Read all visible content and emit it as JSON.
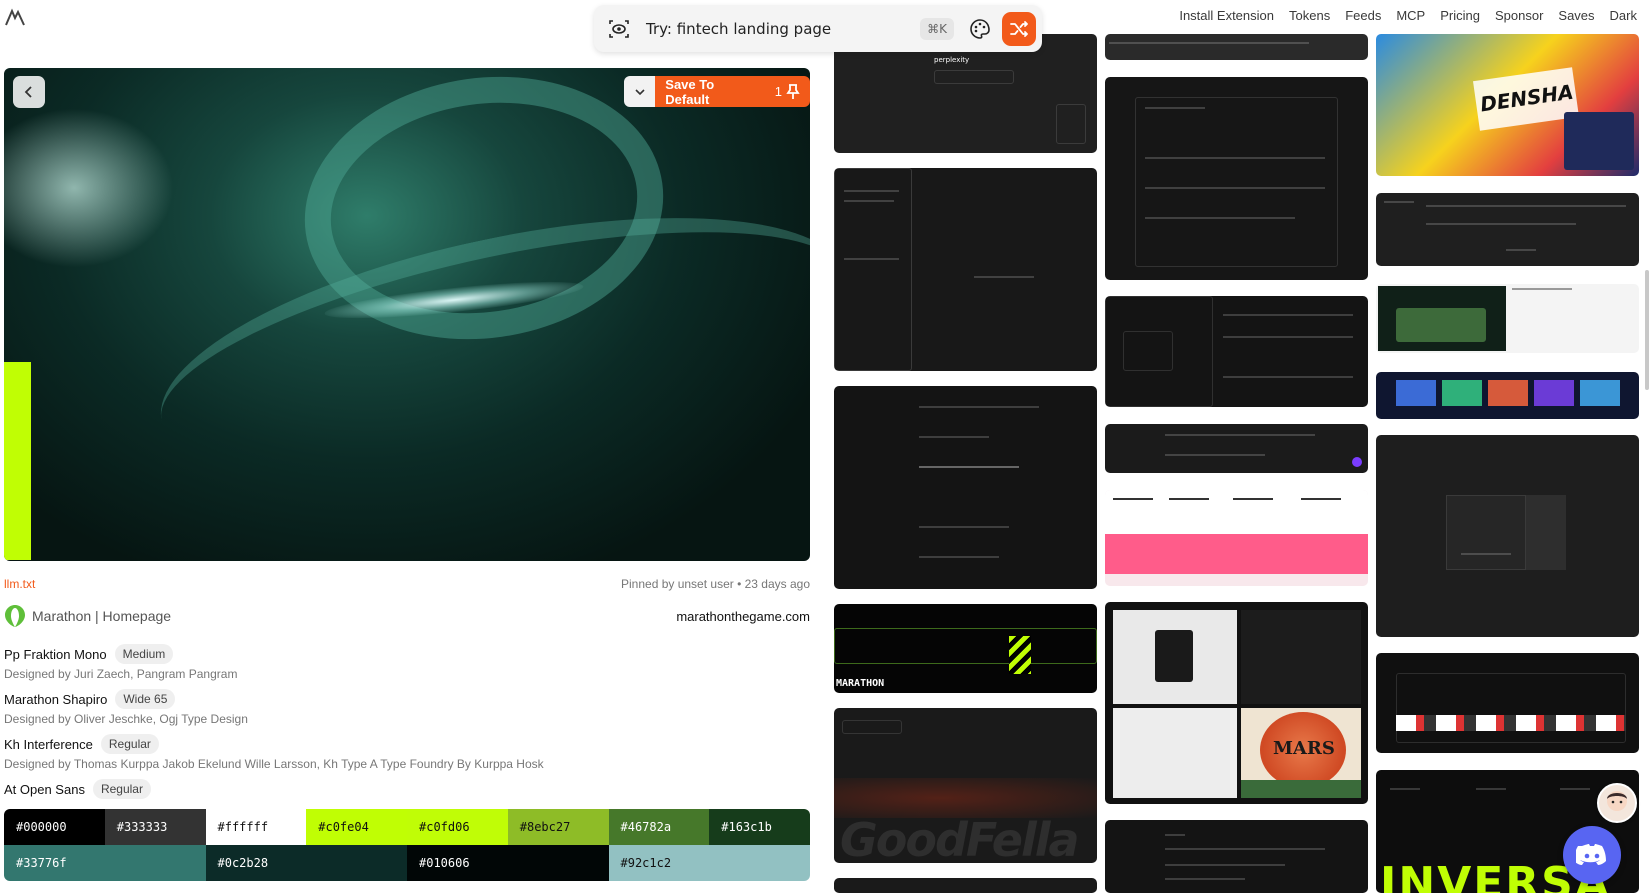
{
  "search": {
    "placeholder": "Try: fintech landing page",
    "shortcut": "⌘K"
  },
  "nav": [
    "Install Extension",
    "Tokens",
    "Feeds",
    "MCP",
    "Pricing",
    "Sponsor",
    "Saves",
    "Dark"
  ],
  "hero": {
    "save_label": "Save To Default",
    "save_count": "1"
  },
  "meta": {
    "llm_link": "llm.txt",
    "pinned": "Pinned by unset user • 23 days ago"
  },
  "site": {
    "name": "Marathon | Homepage",
    "url": "marathonthegame.com"
  },
  "fonts": [
    {
      "name": "Pp Fraktion Mono",
      "weight": "Medium",
      "designer": "Designed by Juri Zaech, Pangram Pangram"
    },
    {
      "name": "Marathon Shapiro",
      "weight": "Wide 65",
      "designer": "Designed by Oliver Jeschke, Ogj Type Design"
    },
    {
      "name": "Kh Interference",
      "weight": "Regular",
      "designer": "Designed by Thomas Kurppa Jakob Ekelund Wille Larsson, Kh Type A Type Foundry By Kurppa Hosk"
    },
    {
      "name": "At Open Sans",
      "weight": "Regular",
      "designer": ""
    }
  ],
  "palette": [
    {
      "hex": "#000000",
      "text": "#ffffff"
    },
    {
      "hex": "#333333",
      "text": "#ffffff"
    },
    {
      "hex": "#ffffff",
      "text": "#111111"
    },
    {
      "hex": "#c0fe04",
      "text": "#111111"
    },
    {
      "hex": "#c0fd06",
      "text": "#111111"
    },
    {
      "hex": "#8ebc27",
      "text": "#111111"
    },
    {
      "hex": "#46782a",
      "text": "#ffffff"
    },
    {
      "hex": "#163c1b",
      "text": "#ffffff"
    },
    {
      "hex": "#33776f",
      "text": "#ffffff"
    },
    {
      "hex": "#0c2b28",
      "text": "#ffffff"
    },
    {
      "hex": "#010606",
      "text": "#ffffff"
    },
    {
      "hex": "#92c1c2",
      "text": "#111111"
    }
  ],
  "thumbs": {
    "perplexity": "perplexity",
    "marathon": "MARATHON",
    "goodfella": "GoodFella",
    "mars": "MARS",
    "inversa": "INVERSA",
    "densha": "DENSHA"
  },
  "colors": {
    "accent": "#f25a1a",
    "lime": "#c0fe04",
    "discord": "#5865f2"
  }
}
